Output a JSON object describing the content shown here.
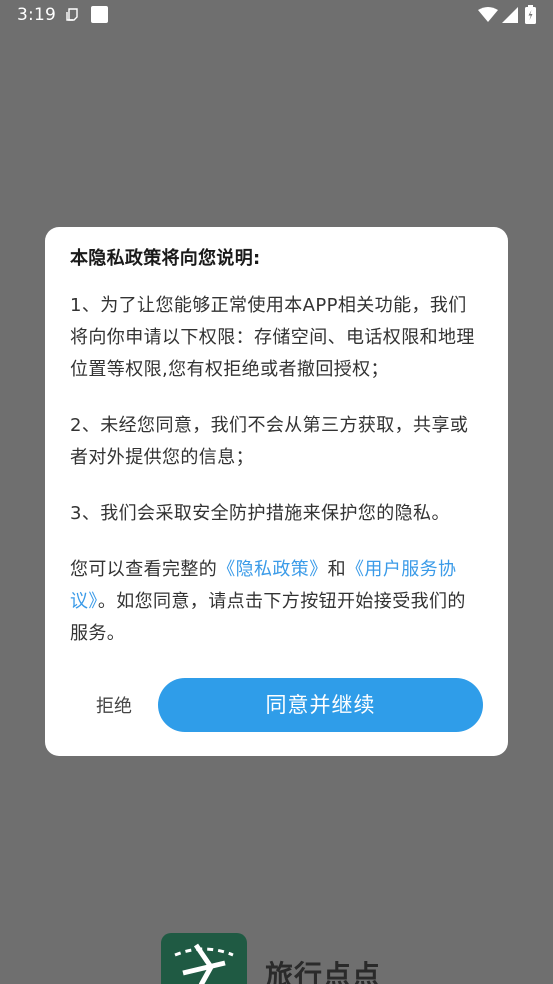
{
  "status_bar": {
    "time": "3:19"
  },
  "dialog": {
    "title": "本隐私政策将向您说明:",
    "para1": "1、为了让您能够正常使用本APP相关功能，我们将向你申请以下权限：存储空间、电话权限和地理位置等权限,您有权拒绝或者撤回授权；",
    "para2": "2、未经您同意，我们不会从第三方获取，共享或者对外提供您的信息；",
    "para3": "3、我们会采取安全防护措施来保护您的隐私。",
    "para4_prefix": "您可以查看完整的",
    "privacy_link": "《隐私政策》",
    "para4_and": "和",
    "terms_link": "《用户服务协议》",
    "para4_suffix": "。如您同意，请点击下方按钮开始接受我们的服务。",
    "reject_label": "拒绝",
    "agree_label": "同意并继续"
  },
  "background": {
    "app_name": "旅行点点"
  },
  "colors": {
    "overlay": "#6f6f6f",
    "accent": "#2f9de9",
    "link": "#3b9be8",
    "logo_bg": "#1f5a43"
  },
  "icons": {
    "status": [
      "notification-icon",
      "square-app-icon",
      "wifi-icon",
      "signal-icon",
      "battery-icon"
    ],
    "logo": "app-logo-icon"
  }
}
